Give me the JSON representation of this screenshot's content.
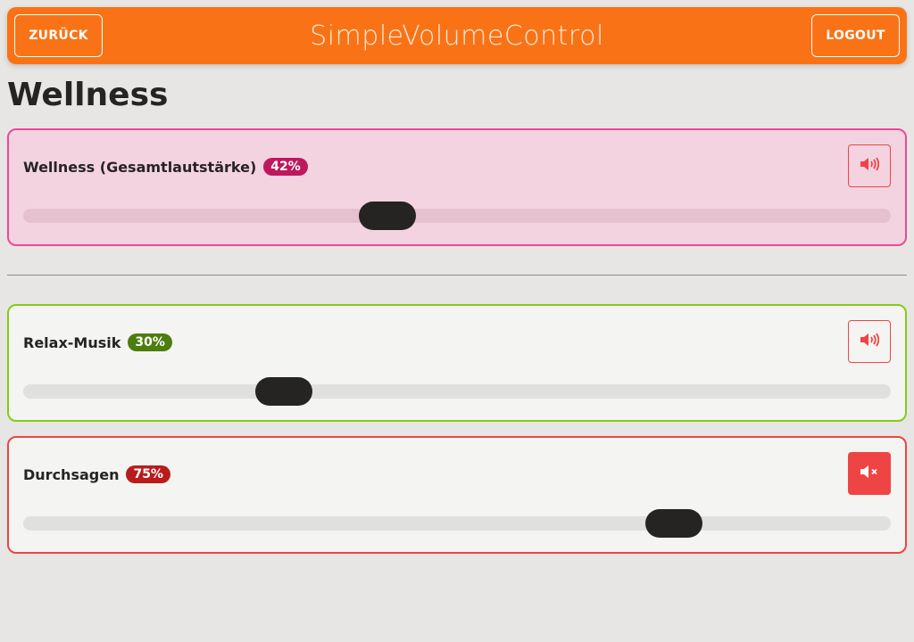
{
  "header": {
    "back_label": "ZURÜCK",
    "app_title": "SimpleVolumeControl",
    "logout_label": "LOGOUT"
  },
  "page": {
    "title": "Wellness"
  },
  "colors": {
    "accent": "#f97316",
    "zone_border": "#ec4899",
    "zone_bg": "#f4d3e1",
    "music_border": "#84cc16",
    "announce_border": "#ef4444",
    "mute_red": "#ef4444"
  },
  "zone": {
    "name": "Wellness (Gesamtlautstärke)",
    "volume_label": "42%",
    "volume": 0.42,
    "badge_color": "#be185d",
    "muted": false,
    "icon": "speaker-on-icon"
  },
  "channels": [
    {
      "name": "Relax-Musik",
      "volume_label": "30%",
      "volume": 0.3,
      "badge_color": "#4d7c0f",
      "border_color": "#84cc16",
      "muted": false,
      "icon": "speaker-on-icon"
    },
    {
      "name": "Durchsagen",
      "volume_label": "75%",
      "volume": 0.75,
      "badge_color": "#b91c1c",
      "border_color": "#ef4444",
      "muted": true,
      "icon": "speaker-muted-icon"
    }
  ]
}
